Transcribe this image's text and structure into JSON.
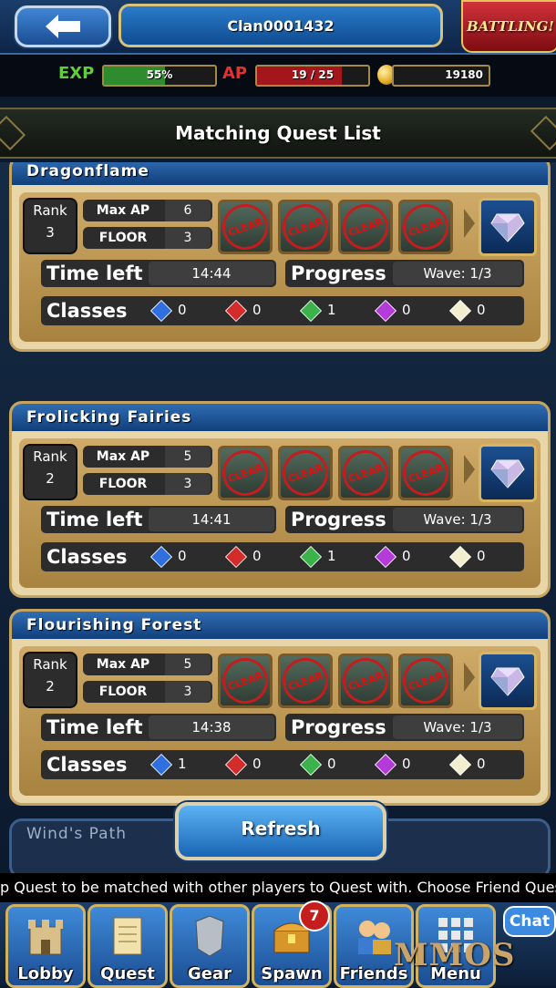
{
  "header": {
    "back_label": "back",
    "clan_name": "Clan0001432",
    "battling_label": "BATTLING!"
  },
  "stats": {
    "exp_label": "EXP",
    "exp_value": "55%",
    "exp_fraction": 0.55,
    "ap_label": "AP",
    "ap_value": "19  /  25",
    "ap_fraction": 0.76,
    "coins": "19180",
    "colors": {
      "exp_fill": "#2e8b2e",
      "ap_fill": "#a3161b",
      "accent_gold": "#d9b561"
    }
  },
  "title": "Matching Quest List",
  "labels": {
    "rank": "Rank",
    "max_ap": "Max AP",
    "floor": "FLOOR",
    "time_left": "Time left",
    "progress": "Progress",
    "classes": "Classes",
    "clear": "CLEAR"
  },
  "quests": [
    {
      "name": "Dragonflame",
      "rank": "3",
      "max_ap": "6",
      "floor": "3",
      "time_left": "14:44",
      "progress": "Wave: 1/3",
      "classes": [
        "0",
        "0",
        "1",
        "0",
        "0"
      ]
    },
    {
      "name": "Frolicking Fairies",
      "rank": "2",
      "max_ap": "5",
      "floor": "3",
      "time_left": "14:41",
      "progress": "Wave: 1/3",
      "classes": [
        "0",
        "0",
        "1",
        "0",
        "0"
      ]
    },
    {
      "name": "Flourishing Forest",
      "rank": "2",
      "max_ap": "5",
      "floor": "3",
      "time_left": "14:38",
      "progress": "Wave: 1/3",
      "classes": [
        "1",
        "0",
        "0",
        "0",
        "0"
      ]
    }
  ],
  "class_icons": [
    {
      "name": "blue-class-gem-icon",
      "color": "#2f6fe0"
    },
    {
      "name": "red-class-gem-icon",
      "color": "#d42b2b"
    },
    {
      "name": "green-class-gem-icon",
      "color": "#3bb24a"
    },
    {
      "name": "purple-class-gem-icon",
      "color": "#b43ad9"
    },
    {
      "name": "white-class-book-icon",
      "color": "#f4eed0"
    }
  ],
  "next_quest_peek": "Wind's Path",
  "refresh_label": "Refresh",
  "ticker_text": "p Quest to be matched with other players to Quest with. Choose Friend  Quest t",
  "nav": [
    {
      "label": "Lobby",
      "icon": "castle-icon"
    },
    {
      "label": "Quest",
      "icon": "scroll-icon"
    },
    {
      "label": "Gear",
      "icon": "armor-icon"
    },
    {
      "label": "Spawn",
      "icon": "treasure-chest-icon",
      "badge": "7"
    },
    {
      "label": "Friends",
      "icon": "friends-icon"
    },
    {
      "label": "Menu",
      "icon": "grid-menu-icon"
    }
  ],
  "chat_label": "Chat",
  "watermark": "MMOS"
}
